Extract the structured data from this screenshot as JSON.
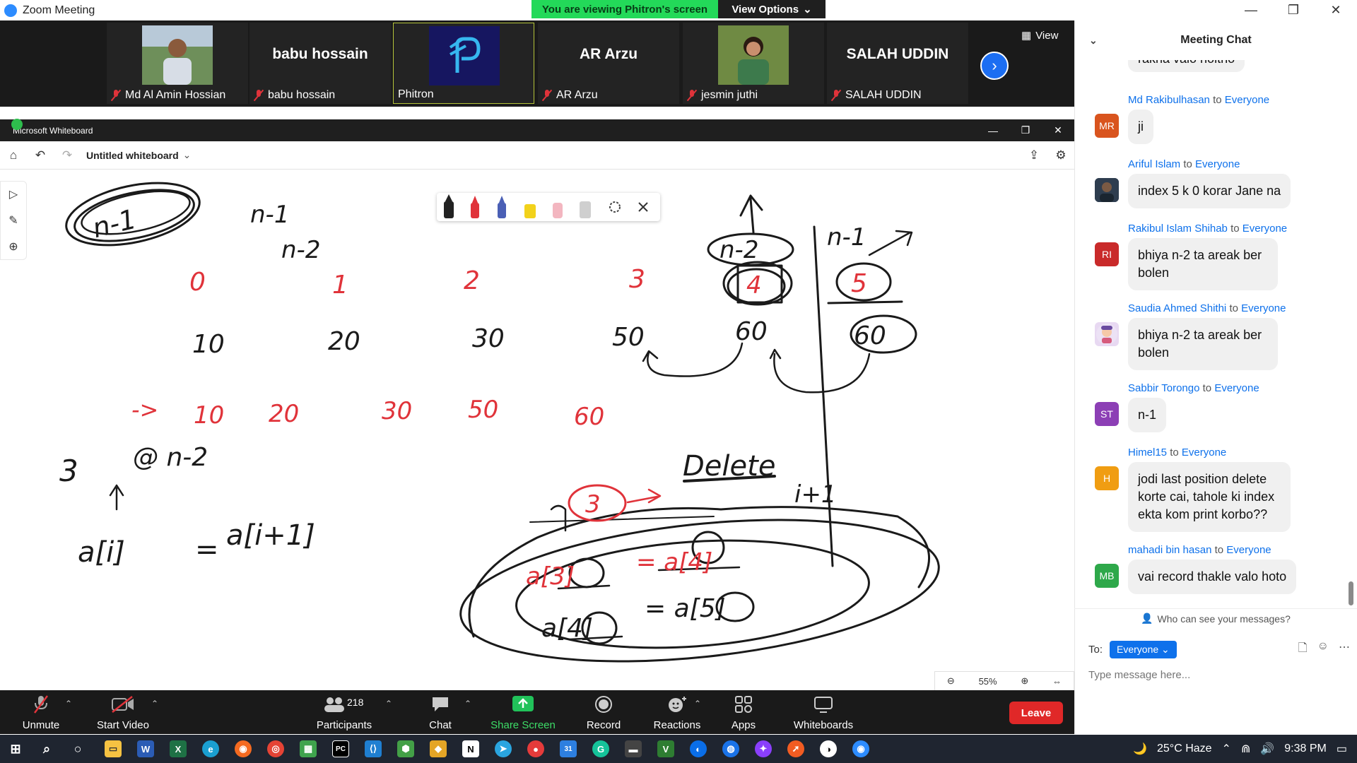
{
  "window": {
    "title": "Zoom Meeting"
  },
  "banner": {
    "viewing": "You are viewing Phitron's screen",
    "options": "View Options"
  },
  "participants_strip": {
    "tiles": [
      {
        "name": "Md Al Amin Hossian",
        "big": ""
      },
      {
        "name": "babu hossain",
        "big": "babu hossain"
      },
      {
        "name": "Phitron",
        "big": ""
      },
      {
        "name": "AR Arzu",
        "big": "AR Arzu"
      },
      {
        "name": "jesmin juthi",
        "big": ""
      },
      {
        "name": "SALAH UDDIN",
        "big": "SALAH UDDIN"
      }
    ],
    "view_label": "View"
  },
  "whiteboard": {
    "app_title": "Microsoft Whiteboard",
    "board_name": "Untitled whiteboard",
    "zoom": "55%",
    "pen_colors": [
      "#222222",
      "#e0333a",
      "#4a5fb5",
      "#f2d21b",
      "#f3b6c0"
    ],
    "drawings": {
      "black_text": [
        "n-1",
        "n-2",
        "10",
        "20",
        "30",
        "50",
        "60",
        "n-2",
        "n-1",
        "5",
        "60",
        "3",
        "@ n-2",
        "a[i]",
        "=",
        "a[i+1]",
        "Delete",
        "i+1",
        "a[4]",
        "= a[5]"
      ],
      "red_text": [
        "0",
        "1",
        "2",
        "3",
        "4",
        "->",
        "10",
        "20",
        "30",
        "50",
        "60",
        "3",
        "->",
        "a[3]",
        "= a[4]"
      ]
    }
  },
  "controls": {
    "unmute": "Unmute",
    "start_video": "Start Video",
    "participants": "Participants",
    "participants_count": "218",
    "chat": "Chat",
    "share_screen": "Share Screen",
    "record": "Record",
    "reactions": "Reactions",
    "apps": "Apps",
    "whiteboards": "Whiteboards",
    "leave": "Leave"
  },
  "chat": {
    "header": "Meeting Chat",
    "partial_top": "rakha valo hoitho",
    "to_word": "to",
    "messages": [
      {
        "sender": "Md Rakibulhasan",
        "to": "Everyone",
        "initials": "MR",
        "color": "#d9541e",
        "text": "ji"
      },
      {
        "sender": "Ariful Islam",
        "to": "Everyone",
        "initials": "",
        "color": "#3a4a5a",
        "text": "index 5 k 0 korar Jane na"
      },
      {
        "sender": "Rakibul Islam Shihab",
        "to": "Everyone",
        "initials": "RI",
        "color": "#c92a2a",
        "text": "bhiya n-2 ta areak ber bolen"
      },
      {
        "sender": "Saudia Ahmed Shithi",
        "to": "Everyone",
        "initials": "",
        "color": "#e8d9f2",
        "text": "bhiya n-2 ta areak ber bolen"
      },
      {
        "sender": "Sabbir Torongo",
        "to": "Everyone",
        "initials": "ST",
        "color": "#8c3fb5",
        "text": "n-1"
      },
      {
        "sender": "Himel15",
        "to": "Everyone",
        "initials": "H",
        "color": "#f09d12",
        "text": "jodi last position delete korte cai, tahole ki index ekta kom print korbo??"
      },
      {
        "sender": "mahadi bin hasan",
        "to": "Everyone",
        "initials": "MB",
        "color": "#2ea84a",
        "text": "vai record thakle valo hoto"
      }
    ],
    "who_can_see": "Who can see your messages?",
    "to_label": "To:",
    "recipient": "Everyone",
    "input_placeholder": "Type message here..."
  },
  "taskbar": {
    "weather": "25°C Haze",
    "time": "9:38 PM"
  }
}
